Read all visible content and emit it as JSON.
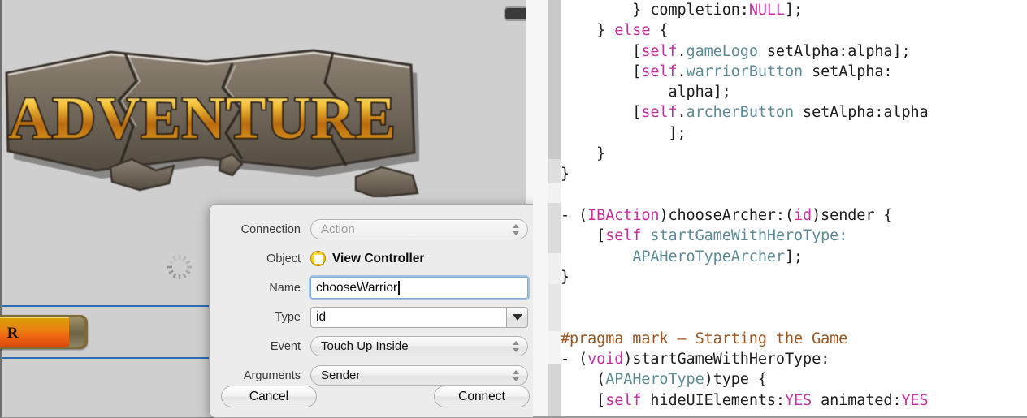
{
  "canvas": {
    "game_logo_text": "ADVENTURE",
    "warrior_button_label": "R",
    "spinner_name": "activity-indicator",
    "badge_name": "status-badge"
  },
  "dialog": {
    "rows": [
      {
        "label": "Connection",
        "value": "Action",
        "control": "popup",
        "disabled": true
      },
      {
        "label": "Object",
        "value": "View Controller",
        "control": "object",
        "disabled": false
      },
      {
        "label": "Name",
        "value": "chooseWarrior",
        "control": "text",
        "disabled": false
      },
      {
        "label": "Type",
        "value": "id",
        "control": "combo",
        "disabled": false
      },
      {
        "label": "Event",
        "value": "Touch Up Inside",
        "control": "popup",
        "disabled": false
      },
      {
        "label": "Arguments",
        "value": "Sender",
        "control": "popup",
        "disabled": false
      }
    ],
    "cancel_label": "Cancel",
    "connect_label": "Connect",
    "accent_focus_color": "#6aa0dc",
    "object_icon_color": "#f6c21c"
  },
  "editor": {
    "language": "Objective-C",
    "colors": {
      "keyword": "#c330a0",
      "type": "#5c8a95",
      "preprocessor": "#9b5622",
      "plain": "#1d1d1d",
      "background": "#ffffff"
    },
    "lines": [
      [
        {
          "t": "        } ",
          "c": "plain"
        },
        {
          "t": "completion:",
          "c": "plain"
        },
        {
          "t": "NULL",
          "c": "kw"
        },
        {
          "t": "];",
          "c": "plain"
        }
      ],
      [
        {
          "t": "    } ",
          "c": "plain"
        },
        {
          "t": "else",
          "c": "kw"
        },
        {
          "t": " {",
          "c": "plain"
        }
      ],
      [
        {
          "t": "        [",
          "c": "plain"
        },
        {
          "t": "self",
          "c": "kw"
        },
        {
          "t": ".",
          "c": "plain"
        },
        {
          "t": "gameLogo",
          "c": "type"
        },
        {
          "t": " setAlpha:alpha];",
          "c": "plain"
        }
      ],
      [
        {
          "t": "        [",
          "c": "plain"
        },
        {
          "t": "self",
          "c": "kw"
        },
        {
          "t": ".",
          "c": "plain"
        },
        {
          "t": "warriorButton",
          "c": "type"
        },
        {
          "t": " setAlpha:",
          "c": "plain"
        }
      ],
      [
        {
          "t": "            alpha];",
          "c": "plain"
        }
      ],
      [
        {
          "t": "        [",
          "c": "plain"
        },
        {
          "t": "self",
          "c": "kw"
        },
        {
          "t": ".",
          "c": "plain"
        },
        {
          "t": "archerButton",
          "c": "type"
        },
        {
          "t": " setAlpha:alpha",
          "c": "plain"
        }
      ],
      [
        {
          "t": "            ];",
          "c": "plain"
        }
      ],
      [
        {
          "t": "    }",
          "c": "plain"
        }
      ],
      [
        {
          "t": "}",
          "c": "plain"
        }
      ],
      [
        {
          "t": "",
          "c": "plain"
        }
      ],
      [
        {
          "t": "- (",
          "c": "plain"
        },
        {
          "t": "IBAction",
          "c": "kw"
        },
        {
          "t": ")chooseArcher:(",
          "c": "plain"
        },
        {
          "t": "id",
          "c": "kw"
        },
        {
          "t": ")sender {",
          "c": "plain"
        }
      ],
      [
        {
          "t": "    [",
          "c": "plain"
        },
        {
          "t": "self",
          "c": "kw"
        },
        {
          "t": " ",
          "c": "plain"
        },
        {
          "t": "startGameWithHeroType:",
          "c": "type"
        }
      ],
      [
        {
          "t": "        ",
          "c": "plain"
        },
        {
          "t": "APAHeroTypeArcher",
          "c": "type"
        },
        {
          "t": "];",
          "c": "plain"
        }
      ],
      [
        {
          "t": "}",
          "c": "plain"
        }
      ],
      [
        {
          "t": "",
          "c": "plain"
        }
      ],
      [
        {
          "t": "",
          "c": "plain"
        }
      ],
      [
        {
          "t": "#pragma mark — Starting the Game",
          "c": "pre"
        }
      ],
      [
        {
          "t": "- (",
          "c": "plain"
        },
        {
          "t": "void",
          "c": "kw"
        },
        {
          "t": ")startGameWithHeroType:",
          "c": "plain"
        }
      ],
      [
        {
          "t": "    (",
          "c": "plain"
        },
        {
          "t": "APAHeroType",
          "c": "type"
        },
        {
          "t": ")type {",
          "c": "plain"
        }
      ],
      [
        {
          "t": "    [",
          "c": "plain"
        },
        {
          "t": "self",
          "c": "kw"
        },
        {
          "t": " hideUIElements:",
          "c": "plain"
        },
        {
          "t": "YES",
          "c": "kw"
        },
        {
          "t": " animated:",
          "c": "plain"
        },
        {
          "t": "YES",
          "c": "kw"
        }
      ]
    ]
  }
}
